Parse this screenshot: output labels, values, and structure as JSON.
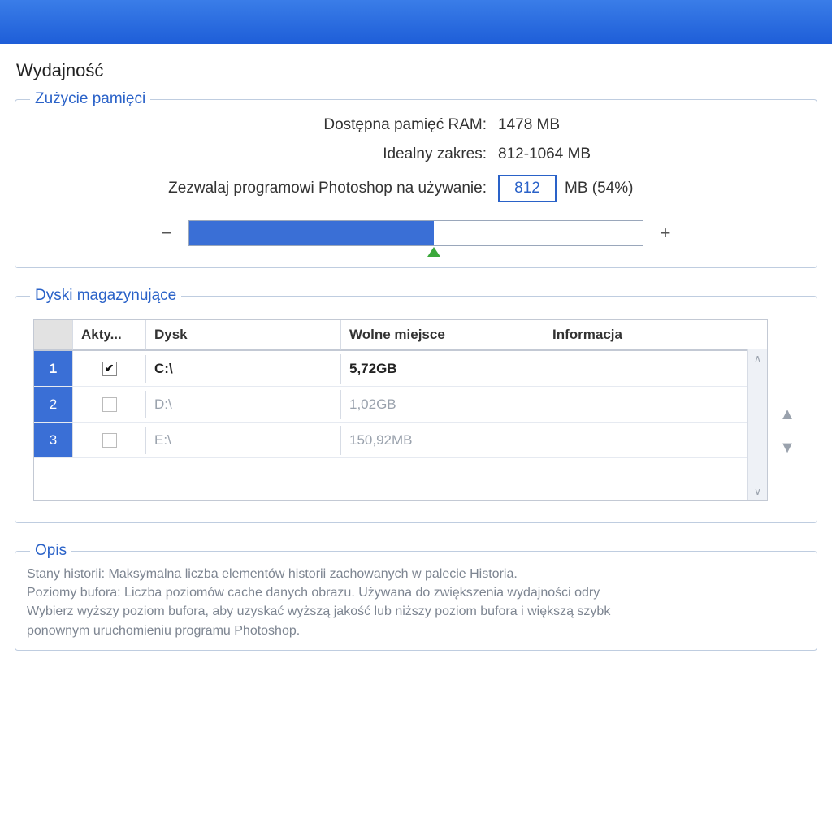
{
  "page_title": "Wydajność",
  "memory": {
    "legend": "Zużycie pamięci",
    "available_label": "Dostępna pamięć RAM:",
    "available_value": "1478 MB",
    "ideal_label": "Idealny zakres:",
    "ideal_value": "812-1064 MB",
    "allow_label": "Zezwalaj programowi Photoshop na używanie:",
    "allow_value": "812",
    "allow_suffix": "MB (54%)",
    "slider_percent": 54,
    "minus": "−",
    "plus": "+"
  },
  "disks": {
    "legend": "Dyski magazynujące",
    "col_active": "Akty...",
    "col_disk": "Dysk",
    "col_free": "Wolne miejsce",
    "col_info": "Informacja",
    "rows": [
      {
        "num": "1",
        "checked": true,
        "disk": "C:\\",
        "free": "5,72GB",
        "info": "",
        "primary": true
      },
      {
        "num": "2",
        "checked": false,
        "disk": "D:\\",
        "free": "1,02GB",
        "info": "",
        "primary": false
      },
      {
        "num": "3",
        "checked": false,
        "disk": "E:\\",
        "free": "150,92MB",
        "info": "",
        "primary": false
      }
    ]
  },
  "description": {
    "legend": "Opis",
    "text": "Stany historii: Maksymalna liczba elementów historii zachowanych w palecie Historia.\nPoziomy bufora: Liczba poziomów cache danych obrazu.  Używana do zwiększenia wydajności odry\nWybierz wyższy poziom bufora, aby uzyskać wyższą jakość lub niższy poziom bufora i większą szybk\nponownym uruchomieniu programu Photoshop."
  }
}
